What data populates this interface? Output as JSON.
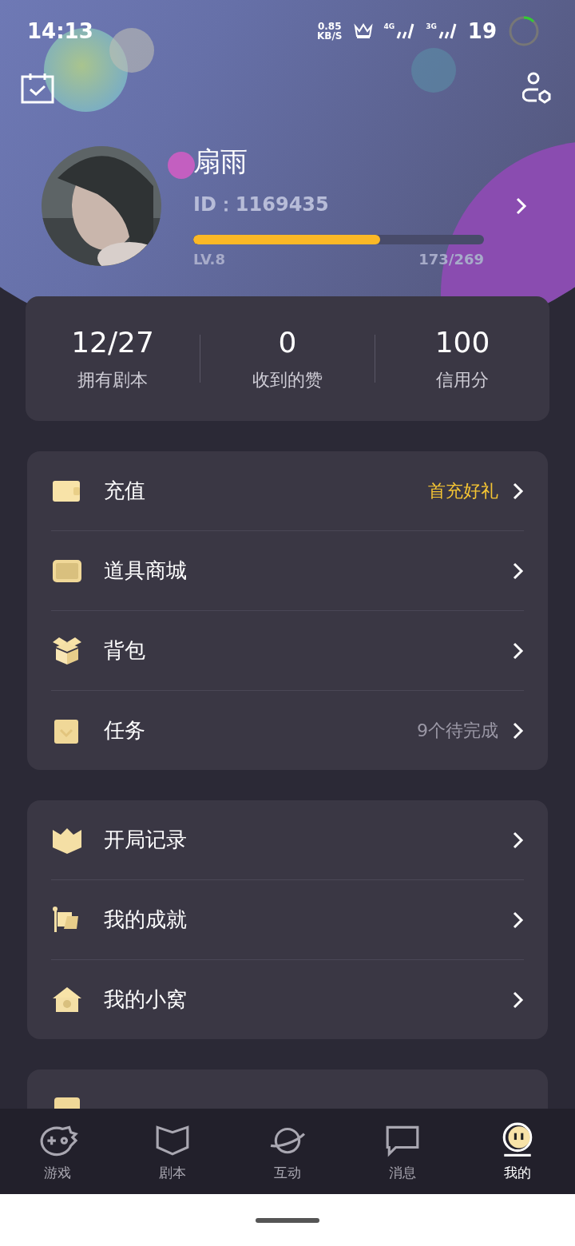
{
  "status_bar": {
    "time": "14:13",
    "speed": "0.85",
    "speed_unit": "KB/S",
    "networks": [
      "4G",
      "3G"
    ],
    "battery": "19"
  },
  "profile": {
    "name": "扇雨",
    "id": "ID：1169435",
    "level": 0.643,
    "level_label": "LV.8",
    "exp": "173/269"
  },
  "stats": [
    {
      "value": "12/27",
      "label": "拥有剧本"
    },
    {
      "value": "0",
      "label": "收到的赞"
    },
    {
      "value": "100",
      "label": "信用分"
    }
  ],
  "menu_groups": [
    [
      {
        "label": "充值",
        "note": "首充好礼",
        "highlight": true
      },
      {
        "label": "道具商城"
      },
      {
        "label": "背包"
      },
      {
        "label": "任务",
        "note": "9个待完成",
        "highlight": false
      }
    ],
    [
      {
        "label": "开局记录"
      },
      {
        "label": "我的成就"
      },
      {
        "label": "我的小窝"
      }
    ]
  ],
  "nav": [
    {
      "label": "游戏",
      "selected": false
    },
    {
      "label": "剧本",
      "selected": false
    },
    {
      "label": "互动",
      "selected": false
    },
    {
      "label": "消息",
      "selected": false
    },
    {
      "label": "我的",
      "selected": true
    }
  ]
}
